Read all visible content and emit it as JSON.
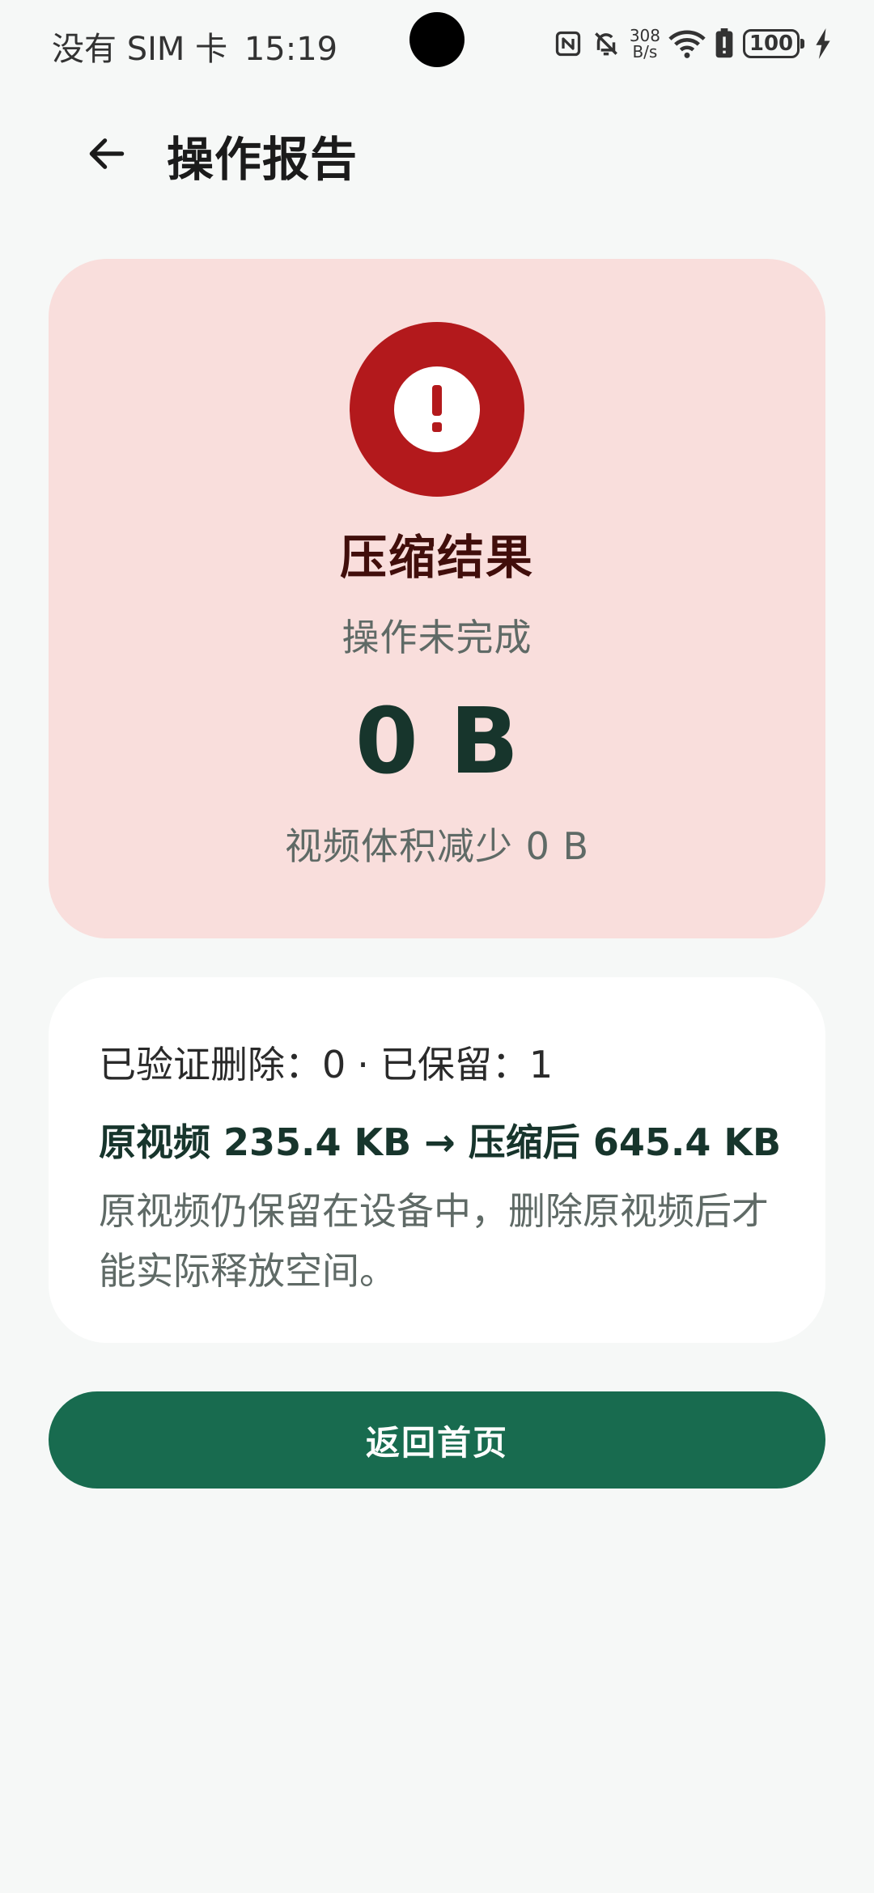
{
  "status_bar": {
    "carrier": "没有 SIM 卡",
    "time": "15:19",
    "net_speed_value": "308",
    "net_speed_unit": "B/s",
    "battery": "100"
  },
  "header": {
    "title": "操作报告"
  },
  "result": {
    "title": "压缩结果",
    "subtitle": "操作未完成",
    "size": "0 B",
    "reduced": "视频体积减少 0 B"
  },
  "info": {
    "verified_deleted_label": "已验证删除：",
    "verified_deleted_value": "0",
    "separator": "·",
    "kept_label": "已保留：",
    "kept_value": "1",
    "sizes": "原视频 235.4 KB → 压缩后 645.4 KB",
    "note": "原视频仍保留在设备中，删除原视频后才能实际释放空间。"
  },
  "actions": {
    "home_label": "返回首页"
  },
  "colors": {
    "accent": "#186b4f",
    "error": "#b3191c",
    "error_container": "#f9dedc",
    "background": "#f6f8f7"
  },
  "icons": {
    "back": "arrow-left-icon",
    "alert": "exclamation-icon",
    "nfc": "nfc-icon",
    "mute": "bell-off-icon",
    "wifi": "wifi-icon",
    "alert_battery": "battery-alert-icon",
    "charging": "bolt-icon"
  }
}
